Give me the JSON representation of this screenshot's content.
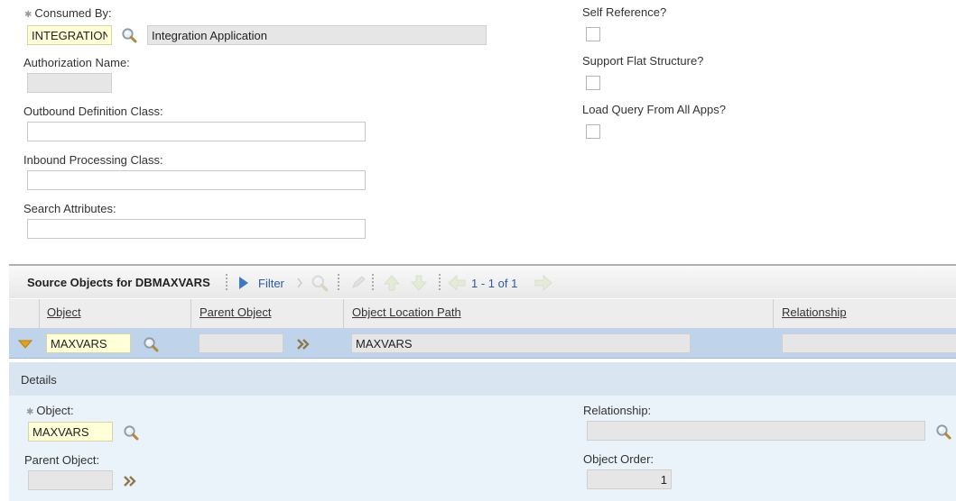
{
  "header_form": {
    "consumed_by_label": "Consumed By:",
    "consumed_by_value": "INTEGRATION",
    "consumed_by_desc": "Integration Application",
    "authorization_name_label": "Authorization Name:",
    "authorization_name_value": "",
    "outbound_definition_class_label": "Outbound Definition Class:",
    "outbound_definition_class_value": "",
    "inbound_processing_class_label": "Inbound Processing Class:",
    "inbound_processing_class_value": "",
    "search_attributes_label": "Search Attributes:",
    "search_attributes_value": "",
    "self_reference_label": "Self Reference?",
    "self_reference_checked": false,
    "support_flat_structure_label": "Support Flat Structure?",
    "support_flat_structure_checked": false,
    "load_query_label": "Load Query From All Apps?",
    "load_query_checked": false
  },
  "table": {
    "title": "Source Objects for DBMAXVARS",
    "filter_label": "Filter",
    "pagination": "1 - 1 of 1",
    "columns": [
      "Object",
      "Parent Object",
      "Object Location Path",
      "Relationship"
    ],
    "rows": [
      {
        "object": "MAXVARS",
        "parent_object": "",
        "object_location_path": "MAXVARS",
        "relationship": ""
      }
    ]
  },
  "details": {
    "title": "Details",
    "object_label": "Object:",
    "object_value": "MAXVARS",
    "parent_object_label": "Parent Object:",
    "parent_object_value": "",
    "relationship_label": "Relationship:",
    "relationship_value": "",
    "object_order_label": "Object Order:",
    "object_order_value": "1"
  },
  "icons": {
    "lookup": "magnifier-icon",
    "goto": "double-chevron-icon",
    "filter": "filter-triangle-icon"
  },
  "colors": {
    "selected_row": "#bfd4ea",
    "details_header": "#d9e5f1",
    "details_body": "#eaf2fa",
    "required_field": "#ffffd8",
    "readonly_field": "#e6e6e6"
  }
}
